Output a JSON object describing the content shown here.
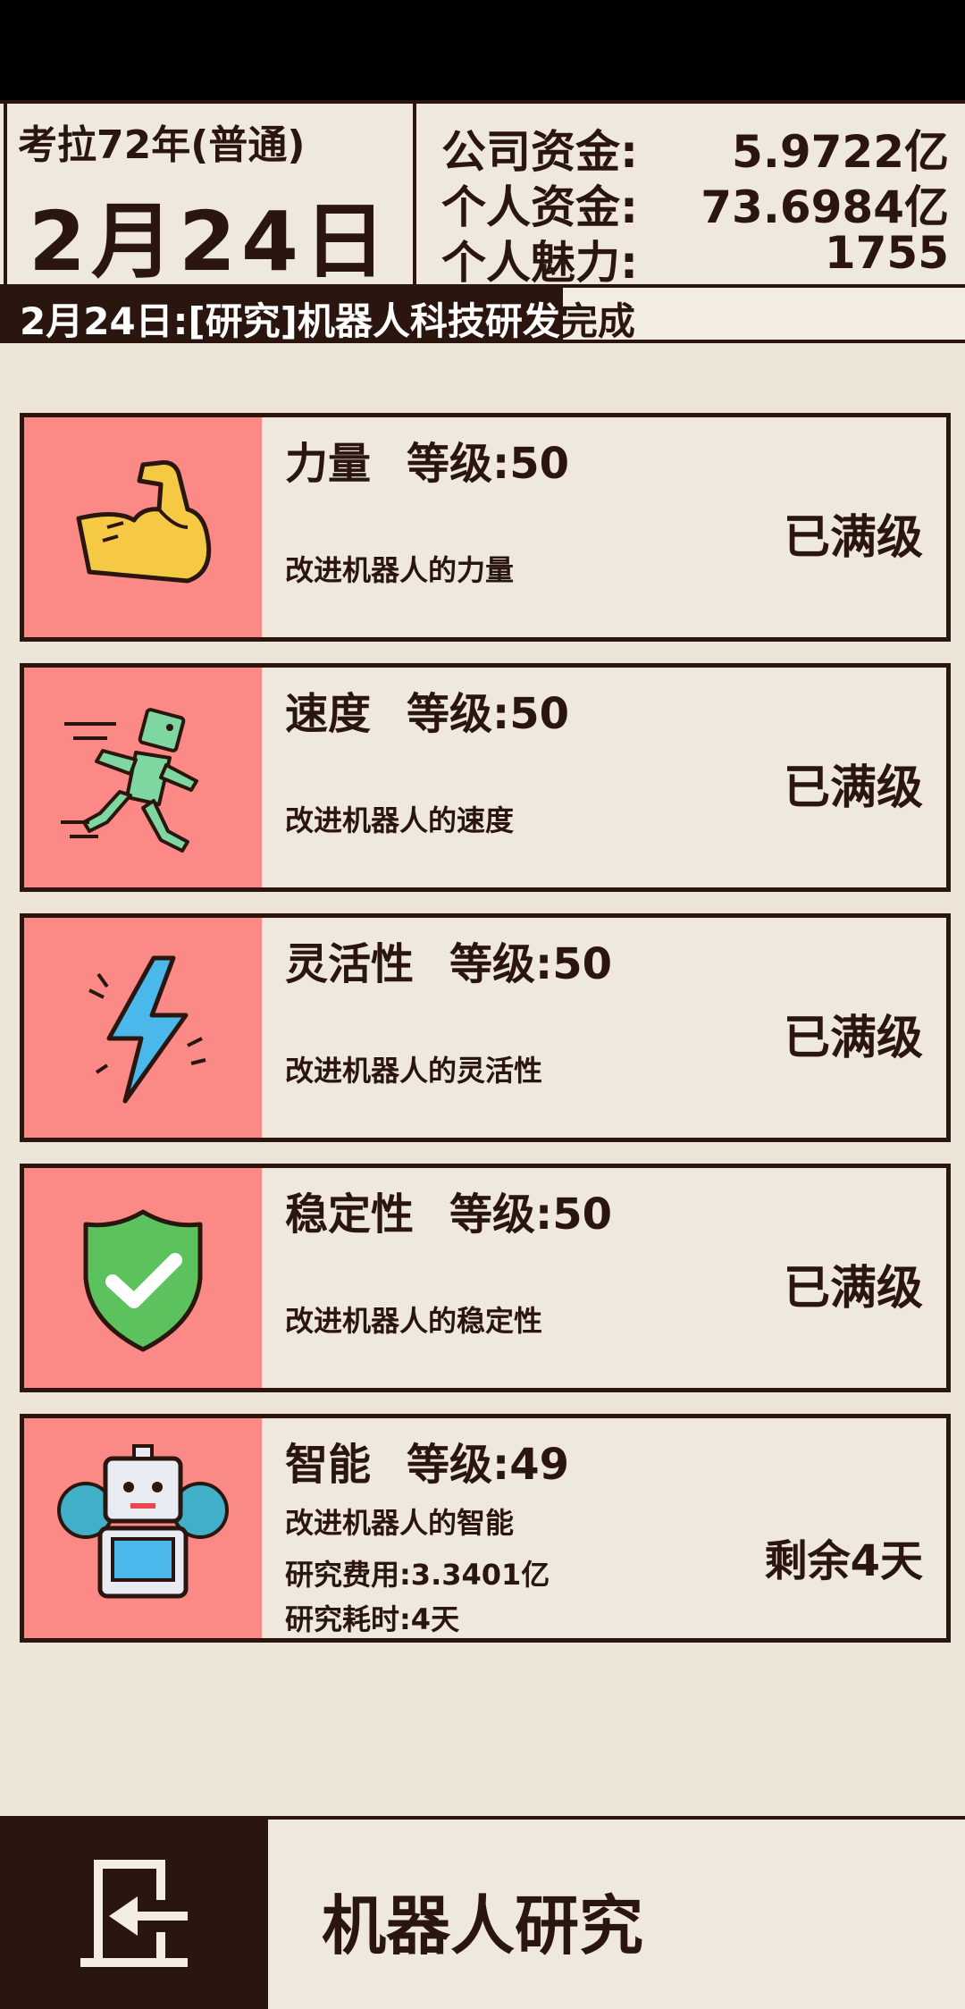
{
  "header": {
    "era": "考拉72年(普通)",
    "date": "2月24日",
    "stats": [
      {
        "label": "公司资金:",
        "value": "5.9722亿"
      },
      {
        "label": "个人资金:",
        "value": "73.6984亿"
      },
      {
        "label": "个人魅力:",
        "value": "1755"
      }
    ]
  },
  "ticker": {
    "highlighted": "2月24日:[研究]机器人科技研发",
    "rest": "完成"
  },
  "research": [
    {
      "name": "力量",
      "level": "等级:50",
      "desc": "改进机器人的力量",
      "status": "已满级",
      "icon": "muscle-arm-icon"
    },
    {
      "name": "速度",
      "level": "等级:50",
      "desc": "改进机器人的速度",
      "status": "已满级",
      "icon": "running-robot-icon"
    },
    {
      "name": "灵活性",
      "level": "等级:50",
      "desc": "改进机器人的灵活性",
      "status": "已满级",
      "icon": "lightning-icon"
    },
    {
      "name": "稳定性",
      "level": "等级:50",
      "desc": "改进机器人的稳定性",
      "status": "已满级",
      "icon": "shield-check-icon"
    },
    {
      "name": "智能",
      "level": "等级:49",
      "desc": "改进机器人的智能",
      "cost": "研究费用:3.3401亿",
      "time": "研究耗时:4天",
      "status": "剩余4天",
      "icon": "robot-gear-icon"
    }
  ],
  "footer": {
    "title": "机器人研究",
    "back_icon": "exit-door-icon"
  },
  "colors": {
    "background": "#ece5d8",
    "dark": "#2a160f",
    "icon_panel": "#fb8a87"
  }
}
